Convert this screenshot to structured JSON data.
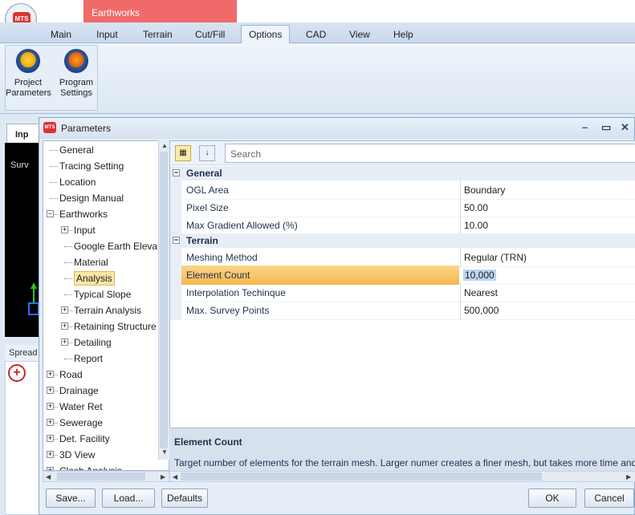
{
  "app": {
    "logo_text": "MTS",
    "context_tab": "Earthworks"
  },
  "ribbon": {
    "tabs": [
      "Main",
      "Input",
      "Terrain",
      "Cut/Fill",
      "Options",
      "CAD",
      "View",
      "Help"
    ],
    "active_tab": "Options",
    "buttons": [
      {
        "label": "Project Parameters",
        "icon": "project-parameters-icon"
      },
      {
        "label": "Program Settings",
        "icon": "program-settings-icon"
      }
    ]
  },
  "background": {
    "input_tab": "Inp",
    "survey_label": "Surv",
    "spread_label": "Spread"
  },
  "dialog": {
    "title": "Parameters",
    "tree": [
      {
        "label": "General",
        "level": 0,
        "expander": ""
      },
      {
        "label": "Tracing Setting",
        "level": 0,
        "expander": ""
      },
      {
        "label": "Location",
        "level": 0,
        "expander": ""
      },
      {
        "label": "Design Manual",
        "level": 0,
        "expander": ""
      },
      {
        "label": "Earthworks",
        "level": 0,
        "expander": "−"
      },
      {
        "label": "Input",
        "level": 1,
        "expander": "+"
      },
      {
        "label": "Google Earth Eleva",
        "level": 1,
        "expander": ""
      },
      {
        "label": "Material",
        "level": 1,
        "expander": ""
      },
      {
        "label": "Analysis",
        "level": 1,
        "expander": "",
        "selected": true
      },
      {
        "label": "Typical Slope",
        "level": 1,
        "expander": ""
      },
      {
        "label": "Terrain Analysis",
        "level": 1,
        "expander": "+"
      },
      {
        "label": "Retaining Structure",
        "level": 1,
        "expander": "+"
      },
      {
        "label": "Detailing",
        "level": 1,
        "expander": "+"
      },
      {
        "label": "Report",
        "level": 1,
        "expander": ""
      },
      {
        "label": "Road",
        "level": 0,
        "expander": "+"
      },
      {
        "label": "Drainage",
        "level": 0,
        "expander": "+"
      },
      {
        "label": "Water Ret",
        "level": 0,
        "expander": "+"
      },
      {
        "label": "Sewerage",
        "level": 0,
        "expander": "+"
      },
      {
        "label": "Det. Facility",
        "level": 0,
        "expander": "+"
      },
      {
        "label": "3D View",
        "level": 0,
        "expander": "+"
      },
      {
        "label": "Clash Analysis",
        "level": 0,
        "expander": "+"
      }
    ],
    "search_placeholder": "Search",
    "categories": [
      {
        "name": "General",
        "properties": [
          {
            "name": "OGL Area",
            "value": "Boundary"
          },
          {
            "name": "Pixel Size",
            "value": "50.00"
          },
          {
            "name": "Max Gradient Allowed (%)",
            "value": "10.00"
          }
        ]
      },
      {
        "name": "Terrain",
        "properties": [
          {
            "name": "Meshing Method",
            "value": "Regular (TRN)"
          },
          {
            "name": "Element Count",
            "value": "10,000",
            "selected": true
          },
          {
            "name": "Interpolation Techinque",
            "value": "Nearest"
          },
          {
            "name": "Max. Survey Points",
            "value": "500,000"
          }
        ]
      }
    ],
    "help": {
      "title": "Element Count",
      "text": "Target number of elements for the terrain mesh. Larger numer creates a finer mesh, but takes more time and"
    },
    "buttons": {
      "save": "Save...",
      "load": "Load...",
      "defaults": "Defaults",
      "ok": "OK",
      "cancel": "Cancel"
    }
  }
}
